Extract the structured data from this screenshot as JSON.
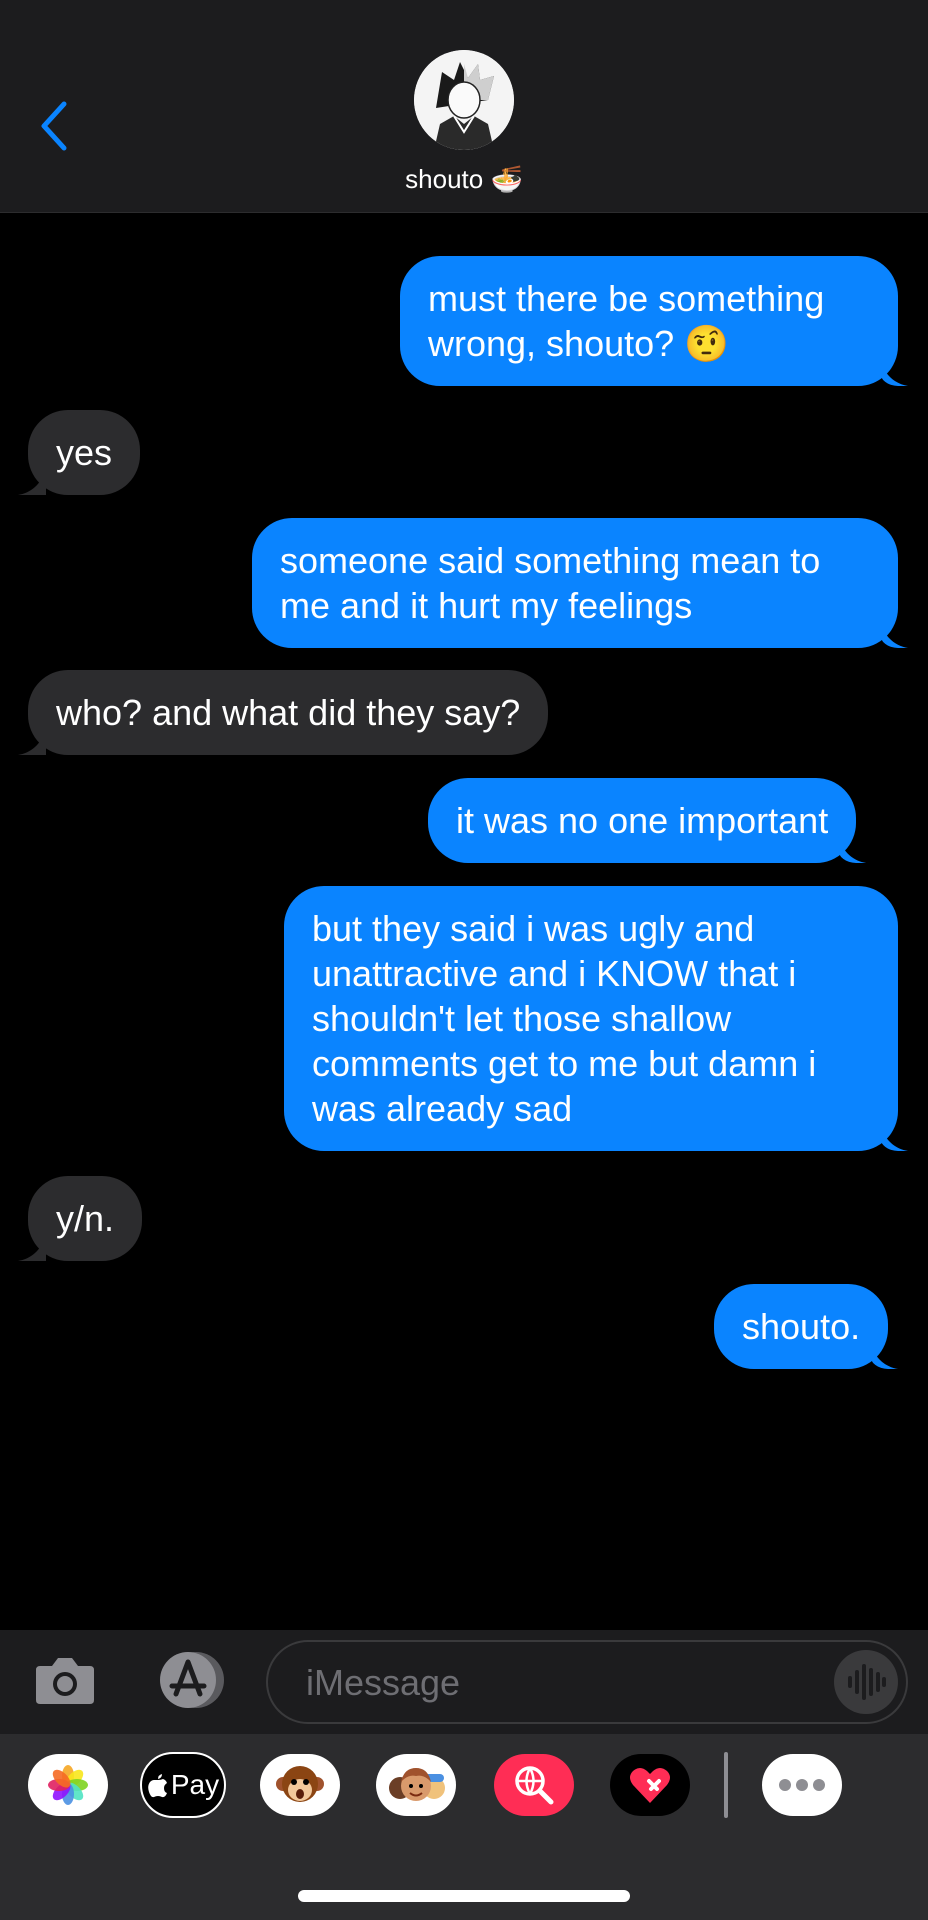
{
  "contact": {
    "name": "shouto",
    "emoji": "🍜"
  },
  "messages": [
    {
      "from": "me",
      "text": "must there be something wrong, shouto? 🤨"
    },
    {
      "from": "them",
      "text": "yes"
    },
    {
      "from": "me",
      "text": "someone said something mean to me and it hurt my feelings"
    },
    {
      "from": "them",
      "text": "who? and what did they say?"
    },
    {
      "from": "me",
      "text": "it was no one important"
    },
    {
      "from": "me",
      "text": "but they said i was ugly and unattractive and i KNOW that i shouldn't let those shallow comments get to me but damn i was already sad"
    },
    {
      "from": "them",
      "text": "y/n."
    },
    {
      "from": "me",
      "text": "shouto."
    }
  ],
  "compose": {
    "placeholder": "iMessage"
  },
  "apps": {
    "applepay_label": "Pay"
  },
  "colors": {
    "outgoing": "#0a84ff",
    "incoming": "#2c2c2e",
    "accent": "#0a84ff"
  }
}
